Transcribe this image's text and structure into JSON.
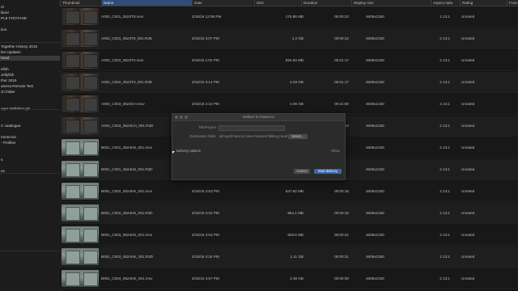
{
  "sidebar": {
    "items": [
      {
        "label": "nt",
        "selected": false
      },
      {
        "label": "lland",
        "selected": false
      },
      {
        "label": "PLE FOOTAGE",
        "selected": false
      },
      {
        "label": "",
        "selected": false
      },
      {
        "label": "tion",
        "selected": false
      },
      {
        "label": "",
        "selected": false
      },
      {
        "label": "",
        "selected": false
      },
      {
        "label": "Together History 2019",
        "selected": false
      },
      {
        "label": "lee Updates",
        "selected": false
      },
      {
        "label": "head",
        "selected": true
      },
      {
        "label": "",
        "selected": false
      },
      {
        "label": "efish",
        "selected": false
      },
      {
        "label": "Jellyfish",
        "selected": false
      },
      {
        "label": "ther 2019",
        "selected": false
      },
      {
        "label": "amera Remote Test",
        "selected": false
      },
      {
        "label": "ch folder",
        "selected": false
      },
      {
        "label": "",
        "selected": false
      },
      {
        "label": "",
        "selected": false
      },
      {
        "label": "ager Walkthrough",
        "selected": false
      },
      {
        "label": "",
        "selected": false
      },
      {
        "label": "",
        "selected": false
      },
      {
        "label": "C catalogue",
        "selected": false
      },
      {
        "label": "",
        "selected": false
      },
      {
        "label": "mmercial",
        "selected": false
      },
      {
        "label": "- Profiles",
        "selected": false
      },
      {
        "label": "",
        "selected": false
      },
      {
        "label": "",
        "selected": false
      },
      {
        "label": "s",
        "selected": false
      },
      {
        "label": "",
        "selected": false
      },
      {
        "label": "es",
        "selected": false
      }
    ]
  },
  "table": {
    "columns": {
      "thumbnail": "Thumbnail",
      "name": "Name",
      "date": "Date",
      "size": "Size",
      "duration": "Duration",
      "display_size": "Display size",
      "aspect_ratio": "Aspect ratio",
      "rating": "Rating",
      "frame": "Frame"
    },
    "rows": [
      {
        "thumb": "dark",
        "name": "A002_C001_0523T9.mov",
        "date": "3/16/19 12:58 PM",
        "size": "178.86 MB",
        "duration": "00:00:22",
        "res": "4608x2160",
        "aspect": "2.13:1",
        "rating": "Unrated"
      },
      {
        "thumb": "dark",
        "name": "A002_C001_0523T9_001.R3D",
        "date": "3/15/19 3:07 PM",
        "size": "1.2 GB",
        "duration": "00:00:22",
        "res": "4608x2160",
        "aspect": "2.13:1",
        "rating": "Unrated"
      },
      {
        "thumb": "dark",
        "name": "A002_C002_0523T0.mov",
        "date": "3/16/19 1:02 PM",
        "size": "594.83 MB",
        "duration": "00:01:17",
        "res": "4608x2160",
        "aspect": "2.13:1",
        "rating": "Unrated"
      },
      {
        "thumb": "dark",
        "name": "A002_C002_0523T0_001.R3D",
        "date": "3/15/19 3:14 PM",
        "size": "4.03 GB",
        "duration": "00:01:17",
        "res": "4608x2160",
        "aspect": "2.13:1",
        "rating": "Unrated"
      },
      {
        "thumb": "dark",
        "name": "A002_C003_0523CH.mov",
        "date": "3/16/19 2:22 PM",
        "size": "4.96 GB",
        "duration": "00:21:50",
        "res": "4608x2160",
        "aspect": "2.13:1",
        "rating": "Unrated"
      },
      {
        "thumb": "dark",
        "name": "A002_C003_0523CH_001.R3D",
        "date": "3/15/19 3:31 PM",
        "size": "",
        "duration": "00:21:50",
        "res": "4608x2160",
        "aspect": "2.13:1",
        "rating": "Unrated"
      },
      {
        "thumb": "light",
        "name": "B001_C001_0524H6_001.mov",
        "date": "",
        "size": "",
        "duration": "",
        "res": "4608x2160",
        "aspect": "2.13:1",
        "rating": "Unrated"
      },
      {
        "thumb": "light",
        "name": "B001_C001_0524H6_001.R3D",
        "date": "",
        "size": "",
        "duration": "",
        "res": "4608x2160",
        "aspect": "2.13:1",
        "rating": "Unrated"
      },
      {
        "thumb": "light",
        "name": "B001_C002_0524H6_001.mov",
        "date": "3/15/19 4:53 PM",
        "size": "647.62 MB",
        "duration": "00:00:16",
        "res": "4608x2160",
        "aspect": "2.13:1",
        "rating": "Unrated"
      },
      {
        "thumb": "light",
        "name": "B001_C002_0524H6_001.R3D",
        "date": "3/15/19 4:34 PM",
        "size": "864.1 MB",
        "duration": "00:00:16",
        "res": "4608x2160",
        "aspect": "2.13:1",
        "rating": "Unrated"
      },
      {
        "thumb": "light",
        "name": "B001_C003_0524H6_001.mov",
        "date": "3/15/19 4:53 PM",
        "size": "825.6 MB",
        "duration": "00:00:21",
        "res": "4608x2160",
        "aspect": "2.13:1",
        "rating": "Unrated"
      },
      {
        "thumb": "light",
        "name": "B001_C003_0524HE_001.R3D",
        "date": "3/15/19 4:34 PM",
        "size": "1.11 GB",
        "duration": "00:00:21",
        "res": "4608x2160",
        "aspect": "2.13:1",
        "rating": "Unrated"
      },
      {
        "thumb": "light",
        "name": "B001_C004_0524HE_001.mov",
        "date": "3/15/19 4:57 PM",
        "size": "2.38 GB",
        "duration": "00:00:00",
        "res": "4608x2160",
        "aspect": "2.13:1",
        "rating": "Unrated"
      }
    ]
  },
  "dialog": {
    "title": "Deliver to Frame.io",
    "title_project_label": "Title/Project",
    "destination_label": "Destination folder",
    "destination_value": "alfongo/Frame.io New Features/Talking Head",
    "select_button": "Select...",
    "delivery_options_label": "Delivery options",
    "show_label": "Show",
    "cancel_button": "Cancel",
    "start_button": "Start delivery"
  },
  "colors": {
    "accent": "#3666b0",
    "header_active": "#2f4d78",
    "background": "#141414"
  }
}
